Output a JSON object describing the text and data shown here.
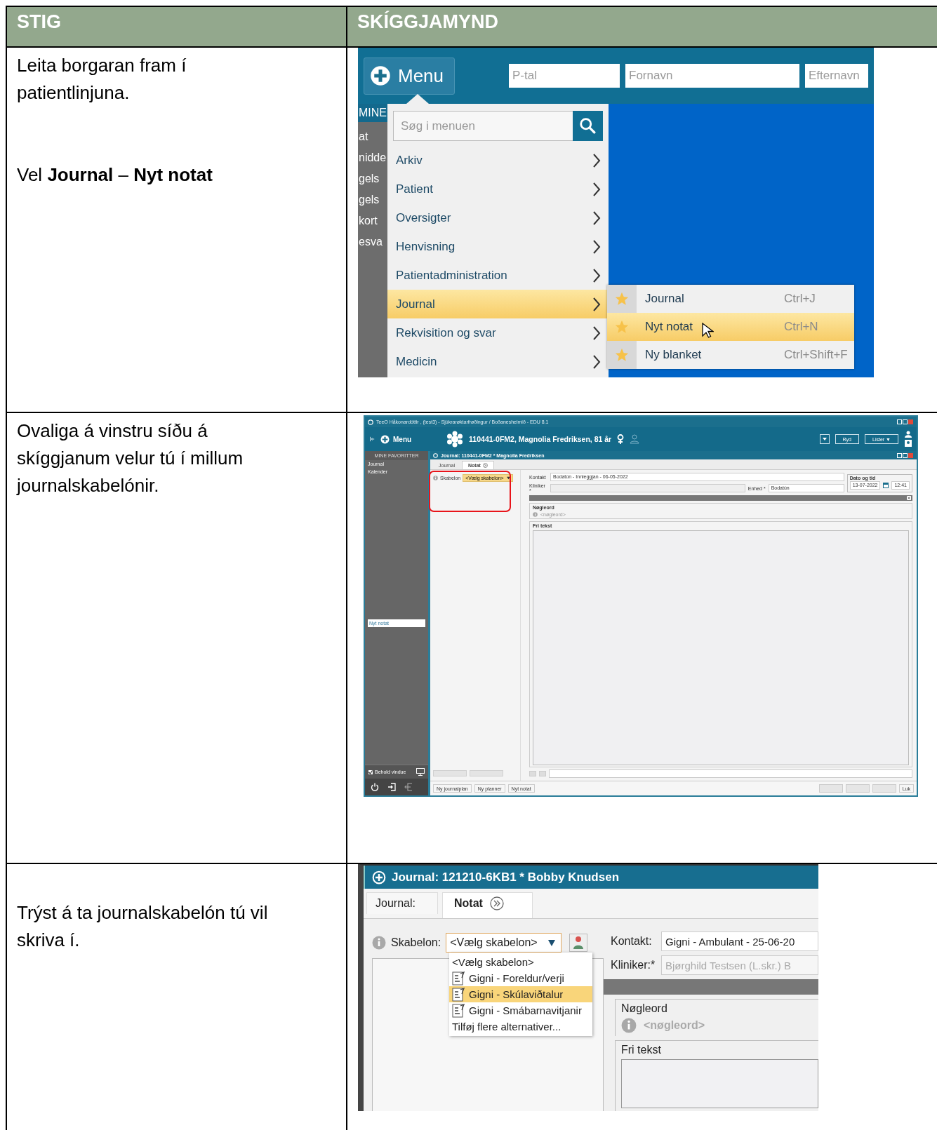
{
  "table": {
    "columns": [
      "STIG",
      "SKÍGGJAMYND"
    ],
    "rows": [
      {
        "step": [
          "Leita borgaran fram í\npatientlinjuna.",
          "Vel **Journal** – **Nyt notat**"
        ],
        "screenshot": {
          "kind": "menu",
          "menu_button": "Menu",
          "fields": [
            {
              "placeholder": "P-tal"
            },
            {
              "placeholder": "Fornavn"
            },
            {
              "placeholder": "Efternavn"
            }
          ],
          "side_labels": [
            "MINE",
            "at",
            "nidde",
            "gels",
            "gels",
            "kort",
            "esva"
          ],
          "search": {
            "placeholder": "Søg i menuen"
          },
          "items": [
            {
              "label": "Arkiv",
              "selected": false
            },
            {
              "label": "Patient",
              "selected": false
            },
            {
              "label": "Oversigter",
              "selected": false
            },
            {
              "label": "Henvisning",
              "selected": false
            },
            {
              "label": "Patientadministration",
              "selected": false
            },
            {
              "label": "Journal",
              "selected": true
            },
            {
              "label": "Rekvisition og svar",
              "selected": false
            },
            {
              "label": "Medicin",
              "selected": false
            }
          ],
          "submenu": [
            {
              "label": "Journal",
              "shortcut": "Ctrl+J",
              "selected": false
            },
            {
              "label": "Nyt notat",
              "shortcut": "Ctrl+N",
              "selected": true
            },
            {
              "label": "Ny blanket",
              "shortcut": "Ctrl+Shift+F",
              "selected": false
            }
          ]
        }
      },
      {
        "step": [
          "Ovaliga á vinstru síðu á\nskíggjanum velur tú í millum\njournalskabelónir."
        ],
        "screenshot": {
          "kind": "window",
          "title": "TeeO Håkonardóttir , (test3) - Sjúkrarøktarfrøðingur / Boðanesheimið - EDU 8.1",
          "menu_button": "Menu",
          "patient": "110441-0FM2,  Magnolia Fredriksen,  81 år",
          "toolbar_buttons": [
            "Ryd",
            "Lister ▼"
          ],
          "favorites_title": "MINE FAVORITTER",
          "favorites": [
            "Journal",
            "Kalender"
          ],
          "open_items": [
            {
              "label": "Nyt notat",
              "selected": true
            }
          ],
          "keep_window": {
            "label": "Behold vindue",
            "checked": true
          },
          "journal_title": "Journal: 110441-0FM2 * Magnolia Fredriksen",
          "tabs": [
            {
              "label": "Journal",
              "selected": false
            },
            {
              "label": "Notat",
              "selected": true
            }
          ],
          "template_label": "Skabelon",
          "template_value": "<Vælg skabelon>",
          "contact_label": "Kontakt",
          "contact_value": "Bodatún - Innleggjan - 06-05-2022",
          "clinician_label": "Kliniker *",
          "unit_label": "Enhed *",
          "unit_value": "Bodatún",
          "date_label": "Dato og tid",
          "date": "13-07-2022",
          "time": "12:41",
          "keyword_label": "Nøgleord",
          "keyword_value": "<nøgleord>",
          "freetext_label": "Fri tekst",
          "footer_buttons": [
            {
              "label": "Ny journalplan"
            },
            {
              "label": "Ny planner"
            },
            {
              "label": "Nyt notat"
            }
          ],
          "close_button": "Luk"
        }
      },
      {
        "step": [
          "Trýst á ta journalskabelón tú vil\nskriva í."
        ],
        "screenshot": {
          "kind": "template",
          "title": "Journal: 121210-6KB1 * Bobby Knudsen",
          "tabs": [
            {
              "label": "Journal:",
              "selected": false
            },
            {
              "label": "Notat",
              "selected": true
            }
          ],
          "template_label": "Skabelon:",
          "template_value": "<Vælg skabelon>",
          "options": [
            {
              "label": "<Vælg skabelon>",
              "kind": "plain",
              "selected": false
            },
            {
              "label": "Gigni - Foreldur/verji",
              "kind": "template",
              "selected": false
            },
            {
              "label": "Gigni - Skúlaviðtalur",
              "kind": "template",
              "selected": true
            },
            {
              "label": "Gigni - Smábarnavitjanir",
              "kind": "template",
              "selected": false
            },
            {
              "label": "Tilføj flere alternativer...",
              "kind": "plain",
              "selected": false
            }
          ],
          "contact_label": "Kontakt:",
          "contact_value": "Gigni - Ambulant -  25-06-20",
          "clinician_label": "Kliniker:*",
          "clinician_value": "Bjørghild Testsen (L.skr.) B",
          "keyword_label": "Nøgleord",
          "keyword_value": "<nøgleord>",
          "freetext_label": "Fri tekst"
        }
      }
    ]
  }
}
